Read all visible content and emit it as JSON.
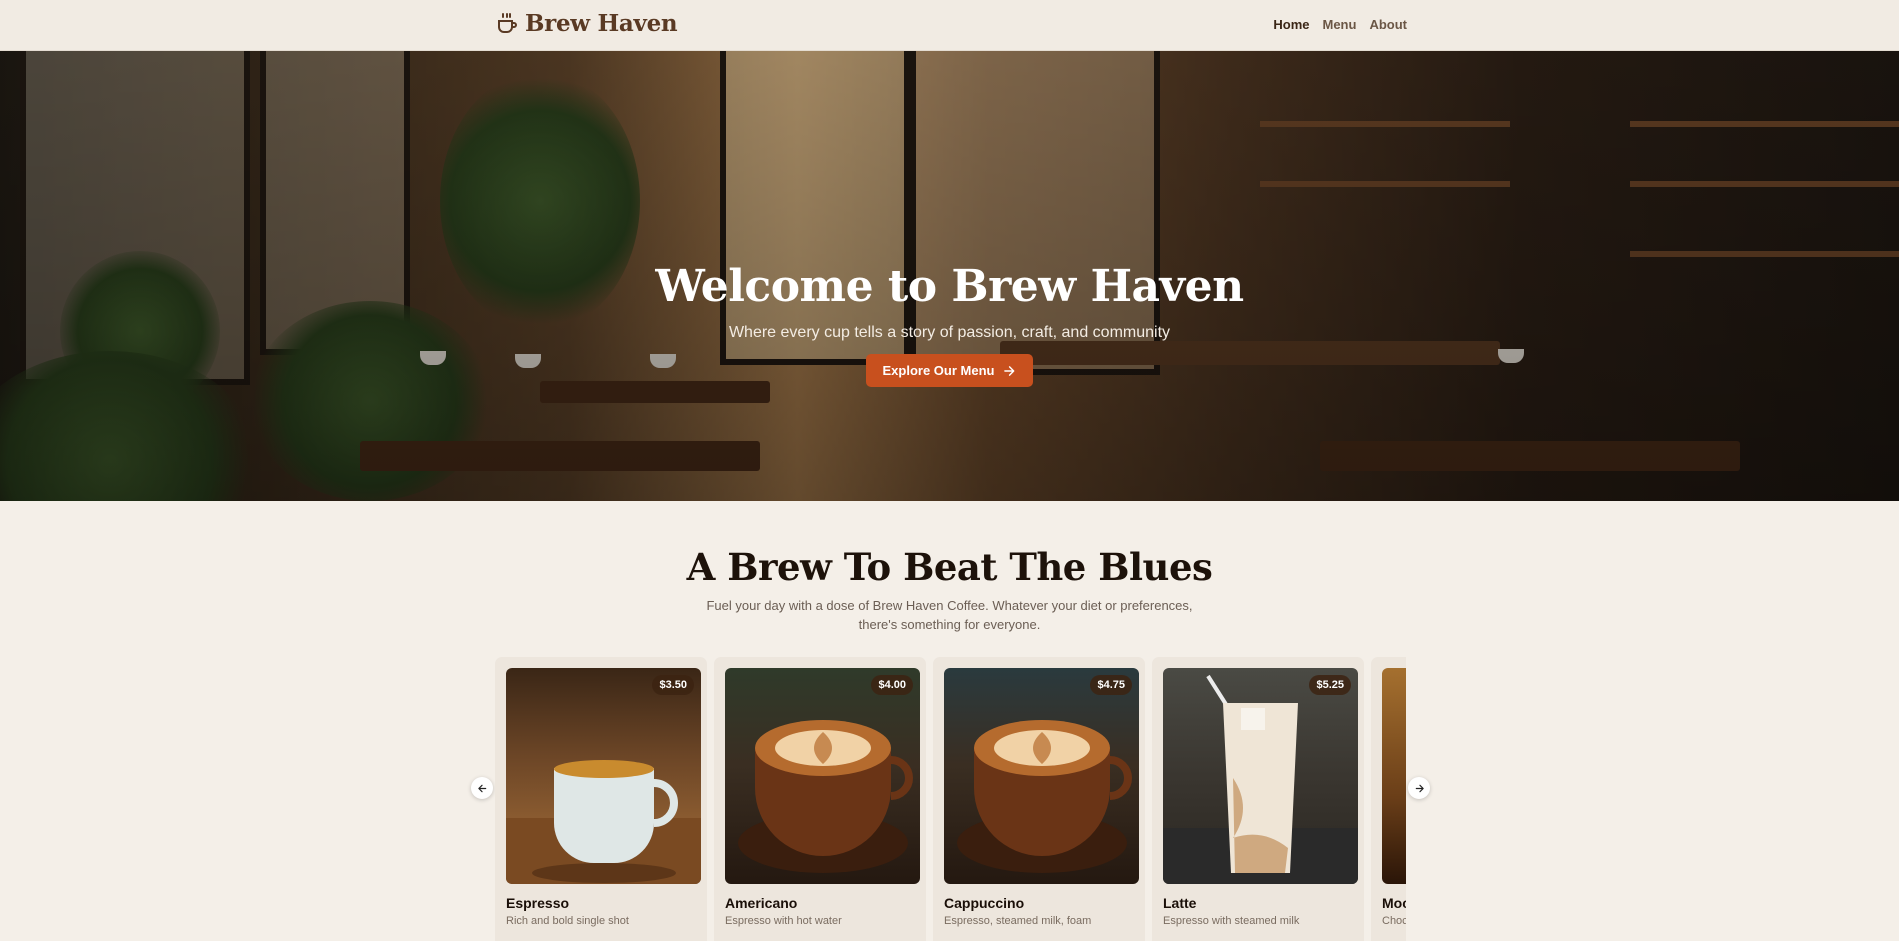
{
  "header": {
    "brand": "Brew Haven",
    "nav": [
      {
        "label": "Home",
        "active": true
      },
      {
        "label": "Menu",
        "active": false
      },
      {
        "label": "About",
        "active": false
      }
    ]
  },
  "hero": {
    "title": "Welcome to Brew Haven",
    "subtitle": "Where every cup tells a story of passion, craft, and community",
    "button": "Explore Our Menu"
  },
  "section": {
    "title": "A Brew To Beat The Blues",
    "description": "Fuel your day with a dose of Brew Haven Coffee. Whatever your diet or preferences, there's something for everyone."
  },
  "products": [
    {
      "name": "Espresso",
      "description": "Rich and bold single shot",
      "price": "$3.50"
    },
    {
      "name": "Americano",
      "description": "Espresso with hot water",
      "price": "$4.00"
    },
    {
      "name": "Cappuccino",
      "description": "Espresso, steamed milk, foam",
      "price": "$4.75"
    },
    {
      "name": "Latte",
      "description": "Espresso with steamed milk",
      "price": "$5.25"
    },
    {
      "name": "Moc",
      "description": "Choc",
      "price": ""
    }
  ],
  "colors": {
    "accent": "#c8501e",
    "brand": "#5a3a24",
    "background": "#f4efe8"
  },
  "icons": {
    "brand": "coffee-cup-icon",
    "hero_button": "arrow-right-icon",
    "carousel_prev": "arrow-left-icon",
    "carousel_next": "arrow-right-icon"
  }
}
